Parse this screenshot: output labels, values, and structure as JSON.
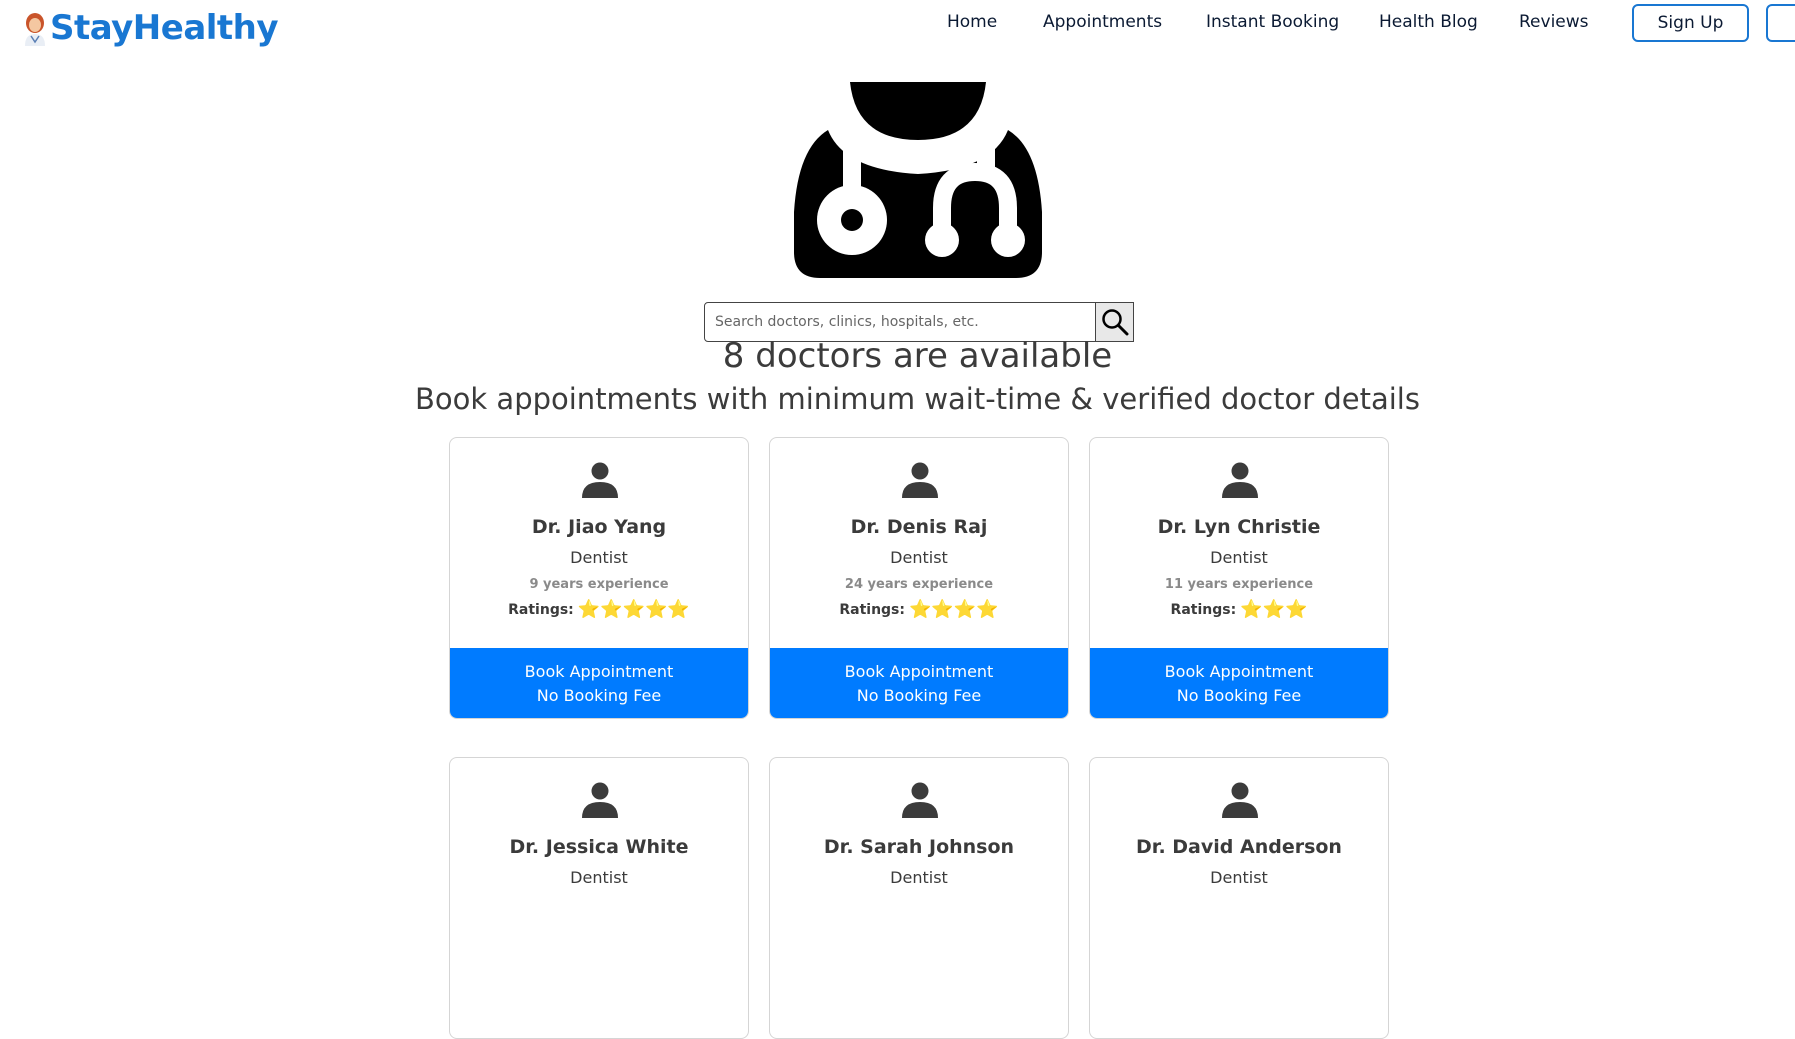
{
  "nav": {
    "brand": "StayHealthy",
    "links": [
      "Home",
      "Appointments",
      "Instant Booking",
      "Health Blog",
      "Reviews"
    ],
    "signup_label": "Sign Up",
    "login_label": ""
  },
  "search": {
    "placeholder": "Search doctors, clinics, hospitals, etc."
  },
  "headline": {
    "count": "8 doctors are available",
    "subtitle": "Book appointments with minimum wait-time & verified doctor details"
  },
  "doctors": [
    {
      "name": "Dr. Jiao Yang",
      "specialty": "Dentist",
      "experience": "9 years experience",
      "ratings_label": "Ratings:",
      "stars": "⭐⭐⭐⭐⭐",
      "rating": 5,
      "book_label": "Book Appointment",
      "fee_label": "No Booking Fee"
    },
    {
      "name": "Dr. Denis Raj",
      "specialty": "Dentist",
      "experience": "24 years experience",
      "ratings_label": "Ratings:",
      "stars": "⭐⭐⭐⭐",
      "rating": 4,
      "book_label": "Book Appointment",
      "fee_label": "No Booking Fee"
    },
    {
      "name": "Dr. Lyn Christie",
      "specialty": "Dentist",
      "experience": "11 years experience",
      "ratings_label": "Ratings:",
      "stars": "⭐⭐⭐",
      "rating": 3,
      "book_label": "Book Appointment",
      "fee_label": "No Booking Fee"
    },
    {
      "name": "Dr. Jessica White",
      "specialty": "Dentist"
    },
    {
      "name": "Dr. Sarah Johnson",
      "specialty": "Dentist"
    },
    {
      "name": "Dr. David Anderson",
      "specialty": "Dentist"
    }
  ],
  "colors": {
    "brand": "#1977d2",
    "primary_button": "#007bff",
    "star": "#f5c518"
  },
  "icons": {
    "logo": "doctor-avatar-icon",
    "hero": "doctor-stethoscope-icon",
    "search": "magnifier-icon",
    "card_avatar": "user-silhouette-icon"
  }
}
